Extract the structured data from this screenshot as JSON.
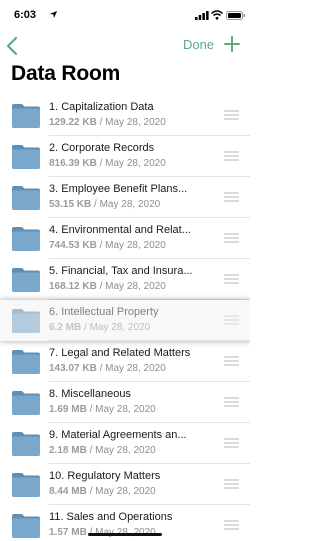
{
  "status": {
    "time": "6:03"
  },
  "nav": {
    "done_label": "Done"
  },
  "page": {
    "title": "Data Room"
  },
  "colors": {
    "accent": "#5cab7d",
    "folder": "#6f9ec3",
    "secondary_text": "#8e8e93"
  },
  "items": [
    {
      "name": "1. Capitalization Data",
      "size": "129.22 KB",
      "date": "May 28, 2020"
    },
    {
      "name": "2. Corporate Records",
      "size": "816.39 KB",
      "date": "May 28, 2020"
    },
    {
      "name": "3. Employee Benefit Plans...",
      "size": "53.15 KB",
      "date": "May 28, 2020"
    },
    {
      "name": "4. Environmental and Relat...",
      "size": "744.53 KB",
      "date": "May 28, 2020"
    },
    {
      "name": "5. Financial, Tax and Insura...",
      "size": "168.12 KB",
      "date": "May 28, 2020"
    },
    {
      "name": "6. Intellectual Property",
      "size": "6.2 MB",
      "date": "May 28, 2020",
      "dragging": true
    },
    {
      "name": "7. Legal and Related Matters",
      "size": "143.07 KB",
      "date": "May 28, 2020"
    },
    {
      "name": "8. Miscellaneous",
      "size": "1.69 MB",
      "date": "May 28, 2020"
    },
    {
      "name": "9. Material Agreements an...",
      "size": "2.18 MB",
      "date": "May 28, 2020"
    },
    {
      "name": "10. Regulatory Matters",
      "size": "8.44 MB",
      "date": "May 28, 2020"
    },
    {
      "name": "11. Sales and Operations",
      "size": "1.57 MB",
      "date": "May 28, 2020"
    }
  ]
}
